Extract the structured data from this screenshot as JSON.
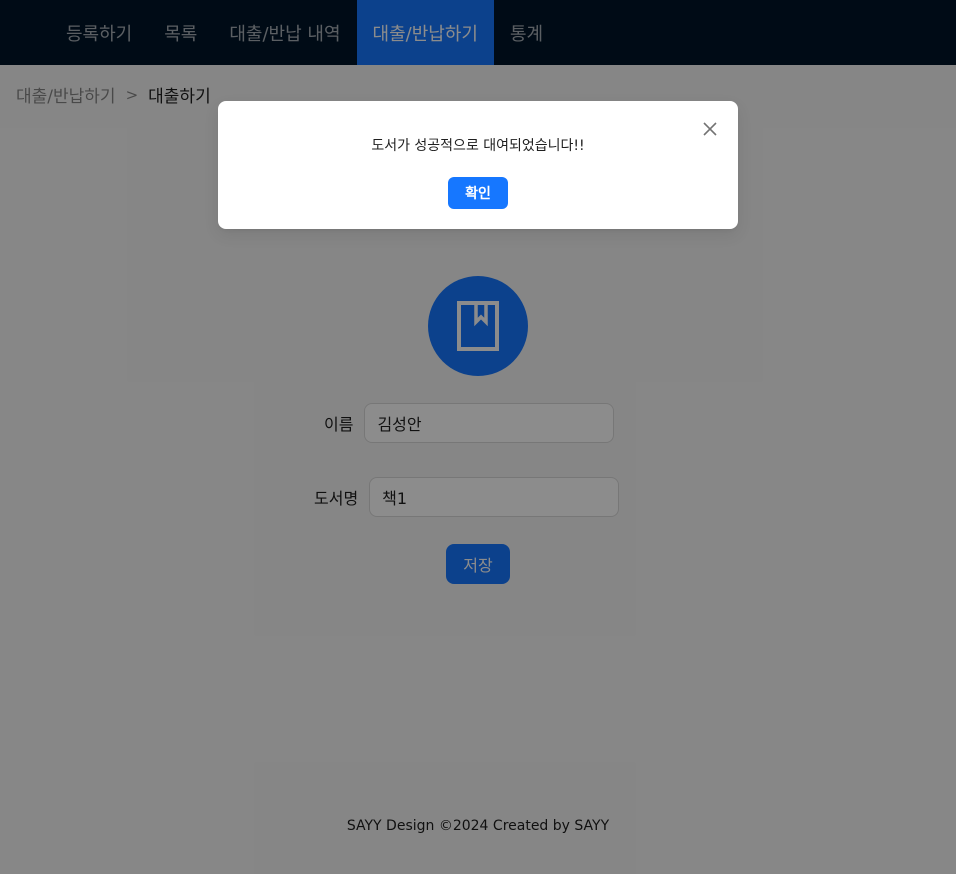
{
  "nav": {
    "items": [
      {
        "label": "등록하기"
      },
      {
        "label": "목록"
      },
      {
        "label": "대출/반납 내역"
      },
      {
        "label": "대출/반납하기",
        "active": true
      },
      {
        "label": "통계"
      }
    ]
  },
  "breadcrumb": {
    "parent": "대출/반납하기",
    "separator": ">",
    "current": "대출하기"
  },
  "avatar": {
    "icon": "book-icon"
  },
  "form": {
    "name_label": "이름",
    "name_value": "김성안",
    "title_label": "도서명",
    "title_value": "책1",
    "save_label": "저장"
  },
  "footer": {
    "text": "SAYY Design ©2024 Created by SAYY"
  },
  "modal": {
    "message": "도서가 성공적으로 대여되었습니다!!",
    "ok_label": "확인",
    "close_icon": "close-icon"
  },
  "colors": {
    "nav_bg": "#001529",
    "primary": "#1677ff",
    "page_bg": "#f5f5f5"
  }
}
